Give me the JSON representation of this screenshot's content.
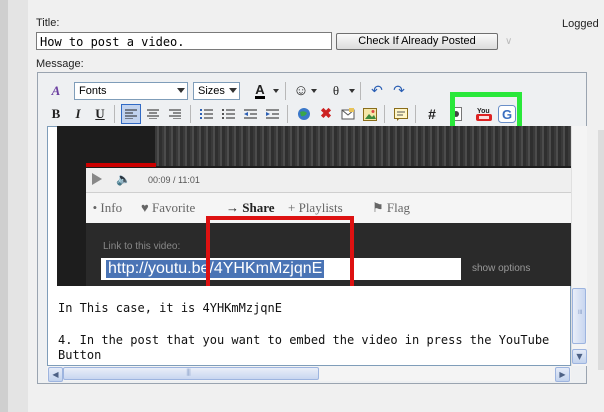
{
  "form": {
    "title_label": "Title:",
    "title_value": "How to post a video.",
    "check_button": "Check If Already Posted",
    "message_label": "Message:",
    "logged_text": "Logged"
  },
  "toolbar": {
    "fonts_select": "Fonts",
    "sizes_select": "Sizes",
    "bold": "B",
    "italic": "I",
    "underline": "U",
    "hash": "#",
    "youtube_label": "You"
  },
  "video": {
    "time": "00:09 / 11:01",
    "tabs": [
      "Info",
      "Favorite",
      "Share",
      "Playlists",
      "Flag"
    ],
    "link_label": "Link to this video:",
    "link_url": "http://youtu.be/4YHKmMzjqnE",
    "show_options": "show options"
  },
  "body": {
    "line1": "In This case, it is 4YHKmMzjqnE",
    "line2": "4.  In the post that you want to embed the video in press the YouTube",
    "line3": "Button"
  },
  "colors": {
    "highlight_green": "#29e83a",
    "highlight_red": "#dd1111",
    "link_selection": "#4a74b5"
  }
}
